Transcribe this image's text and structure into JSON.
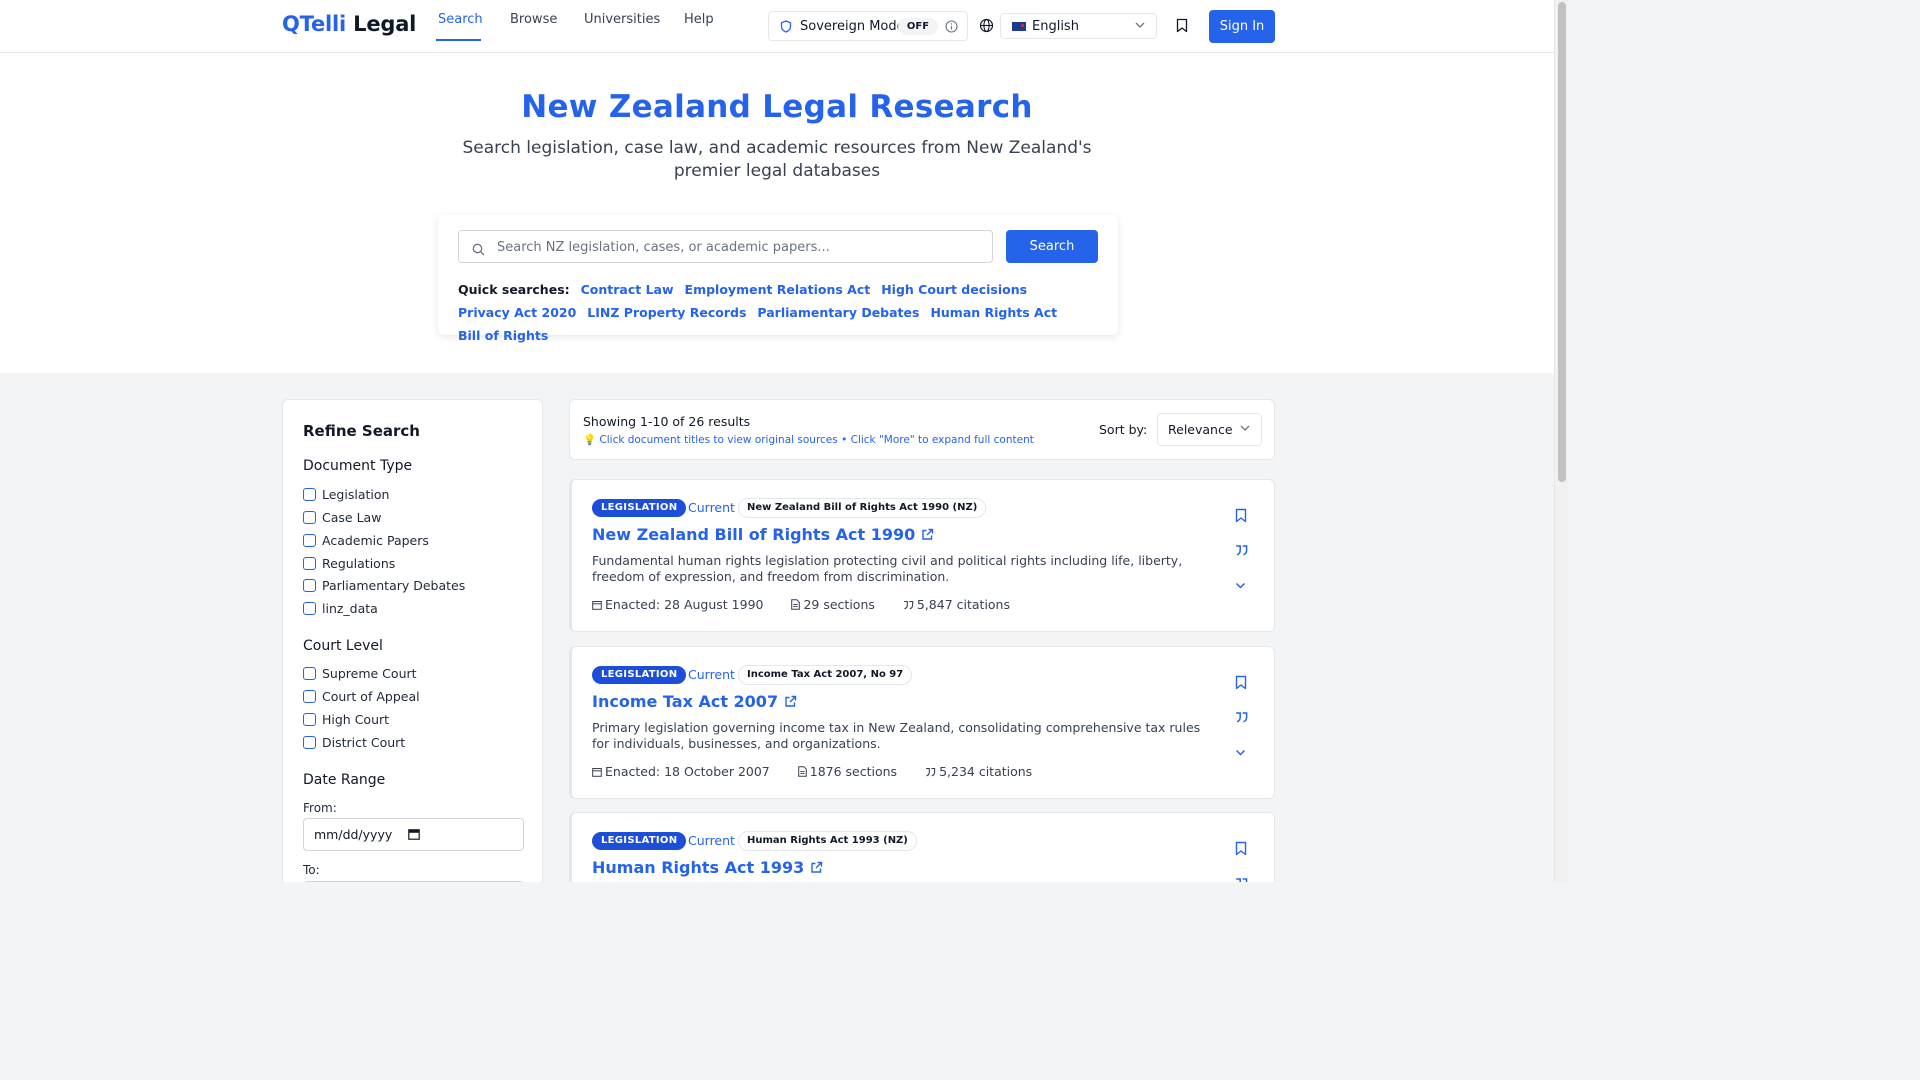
{
  "header": {
    "logo_q": "QTelli",
    "logo_rest": "Legal",
    "nav": [
      "Search",
      "Browse",
      "Universities",
      "Help"
    ],
    "sovereign_label": "Sovereign Mode",
    "sovereign_state": "OFF",
    "language": "English",
    "sign_in": "Sign In"
  },
  "hero": {
    "title": "New Zealand Legal Research",
    "subtitle": "Search legislation, case law, and academic resources from New Zealand's premier legal databases",
    "search_placeholder": "Search NZ legislation, cases, or academic papers...",
    "search_button": "Search",
    "quick_label": "Quick searches:",
    "quick_searches": [
      "Contract Law",
      "Employment Relations Act",
      "High Court decisions",
      "Privacy Act 2020",
      "LINZ Property Records",
      "Parliamentary Debates",
      "Human Rights Act",
      "Bill of Rights"
    ]
  },
  "filters": {
    "title": "Refine Search",
    "document_type_title": "Document Type",
    "document_types": [
      "Legislation",
      "Case Law",
      "Academic Papers",
      "Regulations",
      "Parliamentary Debates",
      "linz_data"
    ],
    "court_level_title": "Court Level",
    "court_levels": [
      "Supreme Court",
      "Court of Appeal",
      "High Court",
      "District Court"
    ],
    "date_range_title": "Date Range",
    "from_label": "From:",
    "from_placeholder": "mm/dd/yyyy",
    "to_label": "To:"
  },
  "results": {
    "count": "Showing 1-10 of 26 results",
    "tip": "💡 Click document titles to view original sources • Click \"More\" to expand full content",
    "sort_label": "Sort by:",
    "sort_value": "Relevance",
    "items": [
      {
        "type": "LEGISLATION",
        "status": "Current",
        "ref": "New Zealand Bill of Rights Act 1990 (NZ)",
        "title": "New Zealand Bill of Rights Act 1990",
        "desc": "Fundamental human rights legislation protecting civil and political rights including life, liberty, freedom of expression, and freedom from discrimination.",
        "enacted": "Enacted: 28 August 1990",
        "sections": "29 sections",
        "citations": "5,847 citations"
      },
      {
        "type": "LEGISLATION",
        "status": "Current",
        "ref": "Income Tax Act 2007, No 97",
        "title": "Income Tax Act 2007",
        "desc": "Primary legislation governing income tax in New Zealand, consolidating comprehensive tax rules for individuals, businesses, and organizations.",
        "enacted": "Enacted: 18 October 2007",
        "sections": "1876 sections",
        "citations": "5,234 citations"
      },
      {
        "type": "LEGISLATION",
        "status": "Current",
        "ref": "Human Rights Act 1993 (NZ)",
        "title": "Human Rights Act 1993",
        "desc": "",
        "enacted": "",
        "sections": "",
        "citations": ""
      }
    ]
  },
  "colors": {
    "accent": "#2563eb",
    "badge": "#1d4ed8"
  }
}
